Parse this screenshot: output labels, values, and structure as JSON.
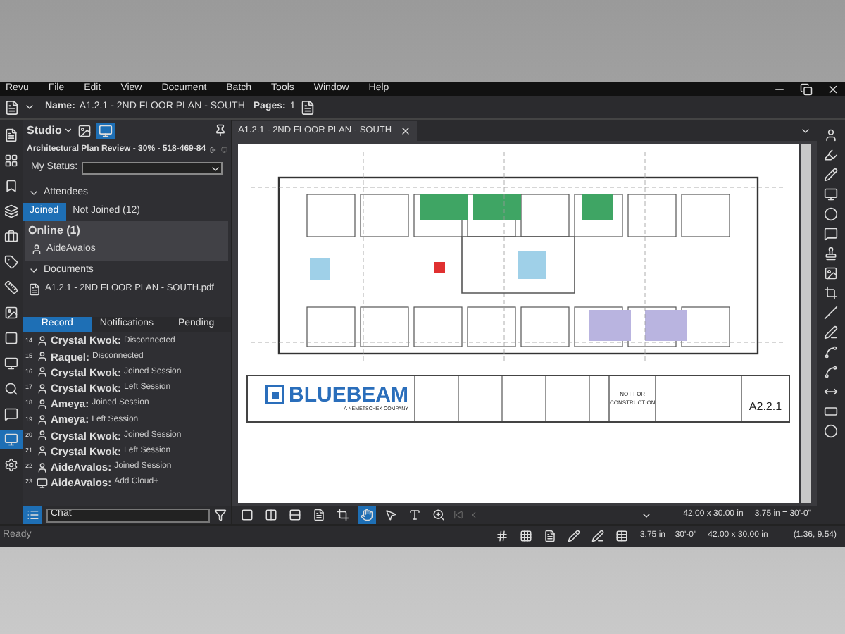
{
  "menu": [
    "Revu",
    "File",
    "Edit",
    "View",
    "Document",
    "Batch",
    "Tools",
    "Window",
    "Help"
  ],
  "toolbar": {
    "name_label": "Name:",
    "name_value": "A1.2.1 - 2ND FLOOR PLAN - SOUTH",
    "pages_label": "Pages:",
    "pages_value": "1"
  },
  "left_tools": [
    {
      "selected": false
    },
    {
      "selected": false
    },
    {
      "selected": false
    },
    {
      "selected": false
    },
    {
      "selected": false
    },
    {
      "selected": false
    },
    {
      "selected": false
    },
    {
      "selected": false
    },
    {
      "selected": false
    },
    {
      "selected": false
    },
    {
      "selected": false
    },
    {
      "selected": false
    },
    {
      "selected": true
    },
    {
      "selected": false
    }
  ],
  "studio": {
    "title": "Studio",
    "session": "Architectural Plan Review - 30% - 518-469-84",
    "status_label": "My Status:",
    "attendees_header": "Attendees",
    "attendee_tabs": [
      {
        "label": "Joined",
        "selected": true
      },
      {
        "label": "Not Joined (12)",
        "selected": false
      }
    ],
    "online_header": "Online (1)",
    "online": [
      "AideAvalos"
    ],
    "documents_header": "Documents",
    "documents": [
      "A1.2.1 - 2ND FLOOR PLAN - SOUTH.pdf"
    ],
    "log_tabs": [
      {
        "label": "Record",
        "selected": true
      },
      {
        "label": "Notifications",
        "selected": false
      },
      {
        "label": "Pending",
        "selected": false
      }
    ],
    "log": [
      {
        "num": "14",
        "name": "Crystal Kwok:",
        "action": "Disconnected",
        "kind": "user"
      },
      {
        "num": "15",
        "name": "Raquel:",
        "action": "Disconnected",
        "kind": "user"
      },
      {
        "num": "16",
        "name": "Crystal Kwok:",
        "action": "Joined Session",
        "kind": "user"
      },
      {
        "num": "17",
        "name": "Crystal Kwok:",
        "action": "Left Session",
        "kind": "user"
      },
      {
        "num": "18",
        "name": "Ameya:",
        "action": "Joined Session",
        "kind": "user"
      },
      {
        "num": "19",
        "name": "Ameya:",
        "action": "Left Session",
        "kind": "user"
      },
      {
        "num": "20",
        "name": "Crystal Kwok:",
        "action": "Joined Session",
        "kind": "user"
      },
      {
        "num": "21",
        "name": "Crystal Kwok:",
        "action": "Left Session",
        "kind": "user"
      },
      {
        "num": "22",
        "name": "AideAvalos:",
        "action": "Joined Session",
        "kind": "user"
      },
      {
        "num": "23",
        "name": "AideAvalos:",
        "action": "Add Cloud+",
        "kind": "cloud"
      }
    ],
    "chat_placeholder": "Chat"
  },
  "document_tab": "A1.2.1 - 2ND FLOOR PLAN - SOUTH",
  "title_block": {
    "logo": "BLUEBEAM",
    "logo_sub": "A NEMETSCHEK COMPANY",
    "stamp": "NOT FOR CONSTRUCTION",
    "sheet": "A2.2.1"
  },
  "view_tools": [
    {
      "selected": false
    },
    {
      "selected": false
    },
    {
      "selected": false
    },
    {
      "selected": false
    },
    {
      "selected": false
    },
    {
      "selected": true
    },
    {
      "selected": false
    },
    {
      "selected": false
    },
    {
      "selected": false
    }
  ],
  "doc_bar": {
    "size": "42.00 x 30.00 in",
    "scale": "3.75 in = 30'-0\""
  },
  "status_bar": {
    "text": "Ready",
    "scale": "3.75 in = 30'-0\"",
    "size": "42.00 x 30.00 in",
    "coords": "(1.36, 9.54)"
  }
}
